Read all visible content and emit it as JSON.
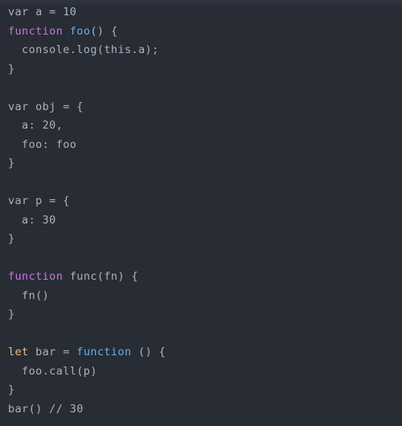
{
  "editor": {
    "title": "JavaScript code snippet",
    "language": "javascript",
    "theme": "One Dark",
    "background_color": "#282c34",
    "default_text_color": "#abb2bf",
    "keyword_color": "#c678dd",
    "function_color": "#61afef",
    "declaration_color": "#e5c07b",
    "font_size_px": 13.5,
    "line_height_px": 23.5
  },
  "code": {
    "lines": [
      {
        "id": 1,
        "text": "var a = 10",
        "tokens": [
          {
            "t": "var a = 10",
            "c": "default"
          }
        ]
      },
      {
        "id": 2,
        "text": "function foo() {",
        "tokens": [
          {
            "t": "function",
            "c": "keyword"
          },
          {
            "t": " ",
            "c": "default"
          },
          {
            "t": "foo",
            "c": "function"
          },
          {
            "t": "() {",
            "c": "default"
          }
        ]
      },
      {
        "id": 3,
        "text": "  console.log(this.a);",
        "tokens": [
          {
            "t": "  console.log(this.a);",
            "c": "default"
          }
        ]
      },
      {
        "id": 4,
        "text": "}",
        "tokens": [
          {
            "t": "}",
            "c": "default"
          }
        ]
      },
      {
        "id": 5,
        "text": "",
        "tokens": [
          {
            "t": " ",
            "c": "default"
          }
        ]
      },
      {
        "id": 6,
        "text": "var obj = {",
        "tokens": [
          {
            "t": "var obj = {",
            "c": "default"
          }
        ]
      },
      {
        "id": 7,
        "text": "  a: 20,",
        "tokens": [
          {
            "t": "  a: 20,",
            "c": "default"
          }
        ]
      },
      {
        "id": 8,
        "text": "  foo: foo",
        "tokens": [
          {
            "t": "  foo: foo",
            "c": "default"
          }
        ]
      },
      {
        "id": 9,
        "text": "}",
        "tokens": [
          {
            "t": "}",
            "c": "default"
          }
        ]
      },
      {
        "id": 10,
        "text": "",
        "tokens": [
          {
            "t": " ",
            "c": "default"
          }
        ]
      },
      {
        "id": 11,
        "text": "var p = {",
        "tokens": [
          {
            "t": "var p = {",
            "c": "default"
          }
        ]
      },
      {
        "id": 12,
        "text": "  a: 30",
        "tokens": [
          {
            "t": "  a: 30",
            "c": "default"
          }
        ]
      },
      {
        "id": 13,
        "text": "}",
        "tokens": [
          {
            "t": "}",
            "c": "default"
          }
        ]
      },
      {
        "id": 14,
        "text": "",
        "tokens": [
          {
            "t": " ",
            "c": "default"
          }
        ]
      },
      {
        "id": 15,
        "text": "function func(fn) {",
        "tokens": [
          {
            "t": "function",
            "c": "keyword"
          },
          {
            "t": " func(fn) {",
            "c": "default"
          }
        ]
      },
      {
        "id": 16,
        "text": "  fn()",
        "tokens": [
          {
            "t": "  fn()",
            "c": "default"
          }
        ]
      },
      {
        "id": 17,
        "text": "}",
        "tokens": [
          {
            "t": "}",
            "c": "default"
          }
        ]
      },
      {
        "id": 18,
        "text": "",
        "tokens": [
          {
            "t": " ",
            "c": "default"
          }
        ]
      },
      {
        "id": 19,
        "text": "let bar = function () {",
        "tokens": [
          {
            "t": "let",
            "c": "declare"
          },
          {
            "t": " bar = ",
            "c": "default"
          },
          {
            "t": "function",
            "c": "function"
          },
          {
            "t": " () {",
            "c": "default"
          }
        ]
      },
      {
        "id": 20,
        "text": "  foo.call(p)",
        "tokens": [
          {
            "t": "  foo.call(p)",
            "c": "default"
          }
        ]
      },
      {
        "id": 21,
        "text": "}",
        "tokens": [
          {
            "t": "}",
            "c": "default"
          }
        ]
      },
      {
        "id": 22,
        "text": "bar() // 30",
        "tokens": [
          {
            "t": "bar() // 30",
            "c": "default"
          }
        ]
      }
    ]
  }
}
